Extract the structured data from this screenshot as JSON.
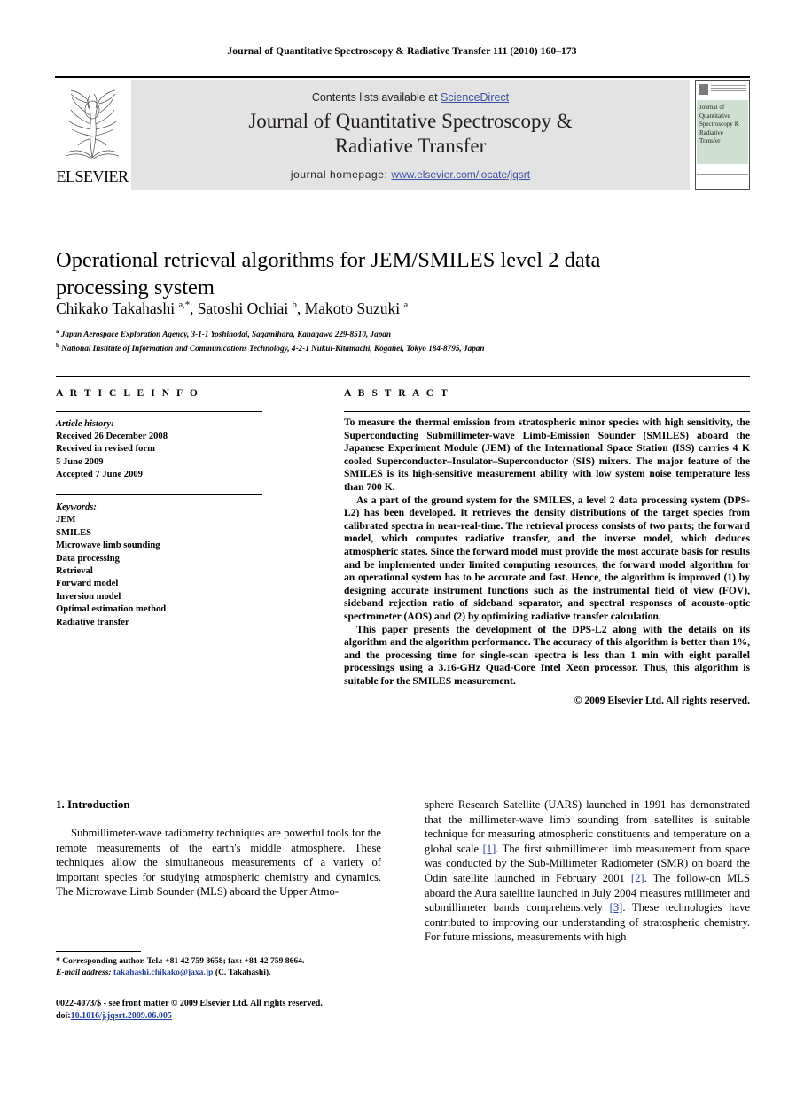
{
  "running_head": "Journal of Quantitative Spectroscopy & Radiative Transfer 111 (2010) 160–173",
  "masthead": {
    "contents_prefix": "Contents lists available at ",
    "sciencedirect": "ScienceDirect",
    "journal_title_line1": "Journal of Quantitative Spectroscopy &",
    "journal_title_line2": "Radiative Transfer",
    "homepage_label": "journal homepage: ",
    "homepage_url": "www.elsevier.com/locate/jqsrt",
    "publisher": "ELSEVIER",
    "publisher_first_letters": "ELS",
    "cover_lines": [
      "Journal of",
      "Quantitative",
      "Spectroscopy &",
      "Radiative",
      "Transfer"
    ],
    "band_color": "#e3e3e3",
    "link_color": "#3a4ea1",
    "cover_band_color": "#cfe0d3"
  },
  "article": {
    "title": "Operational retrieval algorithms for JEM/SMILES level 2 data processing system",
    "authors_html": "Chikako Takahashi <sup>a,*</sup>, Satoshi Ochiai <sup>b</sup>, Makoto Suzuki <sup>a</sup>",
    "affiliation_a": "Japan Aerospace Exploration Agency, 3-1-1 Yoshinodai, Sagamihara, Kanagawa 229-8510, Japan",
    "affiliation_b": "National Institute of Information and Communications Technology, 4-2-1 Nukui-Kitamachi, Koganei, Tokyo 184-8795, Japan"
  },
  "info": {
    "heading": "A R T I C L E    I N F O",
    "history_label": "Article history:",
    "history": [
      "Received 26 December 2008",
      "Received in revised form",
      "5 June 2009",
      "Accepted 7 June 2009"
    ],
    "keywords_label": "Keywords:",
    "keywords": [
      "JEM",
      "SMILES",
      "Microwave limb sounding",
      "Data processing",
      "Retrieval",
      "Forward model",
      "Inversion model",
      "Optimal estimation method",
      "Radiative transfer"
    ]
  },
  "abstract": {
    "heading": "A B S T R A C T",
    "paragraphs": [
      "To measure the thermal emission from stratospheric minor species with high sensitivity, the Superconducting Submillimeter-wave Limb-Emission Sounder (SMILES) aboard the Japanese Experiment Module (JEM) of the International Space Station (ISS) carries 4 K cooled Superconductor–Insulator–Superconductor (SIS) mixers. The major feature of the SMILES is its high-sensitive measurement ability with low system noise temperature less than 700 K.",
      "As a part of the ground system for the SMILES, a level 2 data processing system (DPS-L2) has been developed. It retrieves the density distributions of the target species from calibrated spectra in near-real-time. The retrieval process consists of two parts; the forward model, which computes radiative transfer, and the inverse model, which deduces atmospheric states. Since the forward model must provide the most accurate basis for results and be implemented under limited computing resources, the forward model algorithm for an operational system has to be accurate and fast. Hence, the algorithm is improved (1) by designing accurate instrument functions such as the instrumental field of view (FOV), sideband rejection ratio of sideband separator, and spectral responses of acousto-optic spectrometer (AOS) and (2) by optimizing radiative transfer calculation.",
      "This paper presents the development of the DPS-L2 along with the details on its algorithm and the algorithm performance. The accuracy of this algorithm is better than 1%, and the processing time for single-scan spectra is less than 1 min with eight parallel processings using a 3.16-GHz Quad-Core Intel Xeon processor. Thus, this algorithm is suitable for the SMILES measurement."
    ],
    "copyright": "© 2009 Elsevier Ltd. All rights reserved."
  },
  "body": {
    "section_number_title": "1.  Introduction",
    "left_paragraph": "Submillimeter-wave radiometry techniques are powerful tools for the remote measurements of the earth's middle atmosphere. These techniques allow the simultaneous measurements of a variety of important species for studying atmospheric chemistry and dynamics. The Microwave Limb Sounder (MLS) aboard the Upper Atmo-",
    "right_paragraph_part1": "sphere Research Satellite (UARS) launched in 1991 has demonstrated that the millimeter-wave limb sounding from satellites is suitable technique for measuring atmospheric constituents and temperature on a global scale ",
    "ref1": "[1]",
    "right_paragraph_part2": ". The first submillimeter limb measurement from space was conducted by the Sub-Millimeter Radiometer (SMR) on board the Odin satellite launched in February 2001 ",
    "ref2": "[2]",
    "right_paragraph_part3": ". The follow-on MLS aboard the Aura satellite launched in July 2004 measures millimeter and submillimeter bands comprehensively ",
    "ref3": "[3]",
    "right_paragraph_part4": ". These technologies have contributed to improving our understanding of stratospheric chemistry. For future missions, measurements with high"
  },
  "footnotes": {
    "corresponding": "* Corresponding author. Tel.: +81 42 759 8658; fax: +81 42 759 8664.",
    "email_label": "E-mail address:",
    "email": "takahashi.chikako@jaxa.jp",
    "email_owner": "(C. Takahashi).",
    "imprint": "0022-4073/$ - see front matter © 2009 Elsevier Ltd. All rights reserved.",
    "doi_label": "doi:",
    "doi": "10.1016/j.jqsrt.2009.06.005"
  }
}
